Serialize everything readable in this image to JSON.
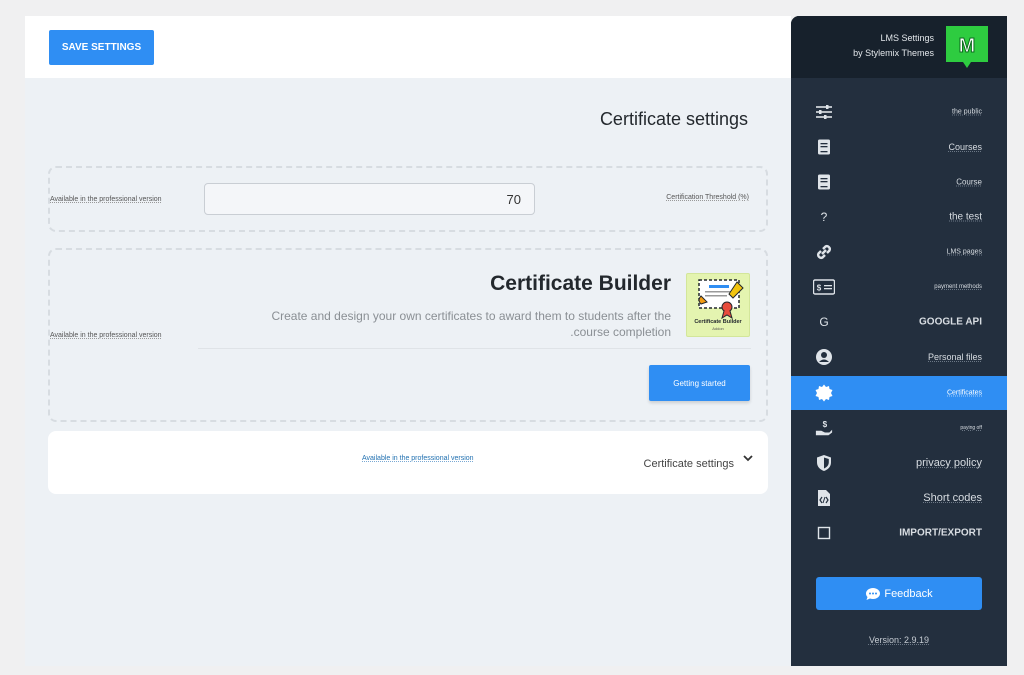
{
  "toolbar": {
    "save_label": "SAVE SETTINGS"
  },
  "page": {
    "title": "Certificate settings"
  },
  "threshold": {
    "pro_note": "Available in the professional version",
    "value": "70",
    "label": "Certification Threshold (%)"
  },
  "builder": {
    "pro_note": "Available in the professional version",
    "title": "Certificate Builder",
    "description": "Create and design your own certificates to award them to students after the .course completion",
    "thumb_label": "Certificate Builder",
    "thumb_sub": "Addon",
    "button_label": "Getting started"
  },
  "accordion": {
    "pro_note": "Available in the professional version",
    "title": "Certificate settings"
  },
  "brand": {
    "title": "LMS Settings",
    "subtitle": "by Stylemix Themes",
    "logo_letter": "M"
  },
  "sidebar": {
    "items": [
      {
        "label": "the public",
        "icon": "sliders-icon"
      },
      {
        "label": "Courses",
        "icon": "book-icon"
      },
      {
        "label": "Course",
        "icon": "book-icon"
      },
      {
        "label": "the test",
        "icon": "question-icon"
      },
      {
        "label": "LMS pages",
        "icon": "link-icon"
      },
      {
        "label": "payment methods",
        "icon": "money-card-icon"
      },
      {
        "label": "GOOGLE API",
        "icon": "google-icon",
        "icon_text": "G"
      },
      {
        "label": "Personal files",
        "icon": "user-circle-icon"
      },
      {
        "label": "Certificates",
        "icon": "certificate-icon",
        "active": true
      },
      {
        "label": "paying off",
        "icon": "hand-dollar-icon"
      },
      {
        "label": "privacy policy",
        "icon": "shield-icon"
      },
      {
        "label": "Short codes",
        "icon": "code-file-icon"
      },
      {
        "label": "IMPORT/EXPORT",
        "icon": "square-icon"
      }
    ]
  },
  "feedback": {
    "label": "Feedback"
  },
  "version": {
    "label": "Version: 2.9.19"
  },
  "colors": {
    "accent": "#2f8ef3",
    "sidebar_bg": "#232f3e",
    "sidebar_header_bg": "#17212c",
    "logo_green": "#2ecc40",
    "page_bg": "#edf1f5"
  }
}
